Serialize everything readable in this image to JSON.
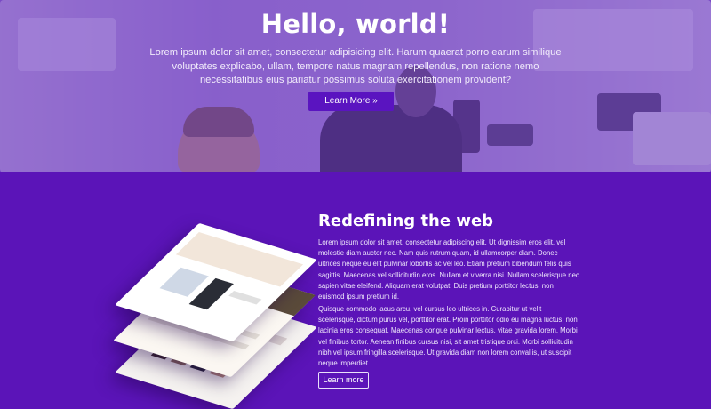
{
  "hero": {
    "title": "Hello, world!",
    "lead": "Lorem ipsum dolor sit amet, consectetur adipisicing elit. Harum quaerat porro earum similique voluptates explicabo, ullam, tempore natus magnam repellendus, non ratione nemo necessitatibus eius pariatur possimus soluta exercitationem provident?",
    "button_label": "Learn More »"
  },
  "feature": {
    "title": "Redefining the web",
    "paragraph_1": "Lorem ipsum dolor sit amet, consectetur adipiscing elit. Ut dignissim eros elit, vel molestie diam auctor nec. Nam quis rutrum quam, id ullamcorper diam. Donec ultrices neque eu elit pulvinar lobortis ac vel leo. Etiam pretium bibendum felis quis sagittis. Maecenas vel sollicitudin eros. Nullam et viverra nisi. Nullam scelerisque nec sapien vitae eleifend. Aliquam erat volutpat. Duis pretium porttitor lectus, non euismod ipsum pretium id.",
    "paragraph_2": "Quisque commodo lacus arcu, vel cursus leo ultrices in. Curabitur ut velit scelerisque, dictum purus vel, porttitor erat. Proin porttitor odio eu magna luctus, non lacinia eros consequat. Maecenas congue pulvinar lectus, vitae gravida lorem. Morbi vel finibus tortor. Aenean finibus cursus nisi, sit amet tristique orci. Morbi sollicitudin nibh vel ipsum fringilla scelerisque. Ut gravida diam non lorem convallis, ut suscipit neque imperdiet.",
    "button_label": "Learn more"
  },
  "colors": {
    "section_purple": "#5b14b8",
    "button_purple": "#5a14c0",
    "hero_tint": "#7846c8"
  }
}
